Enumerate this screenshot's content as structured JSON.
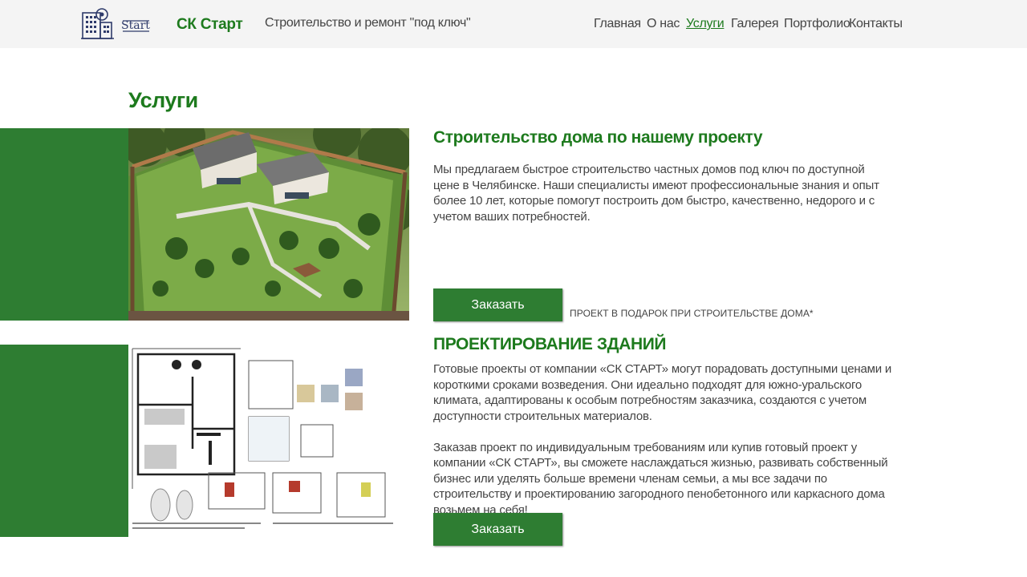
{
  "header": {
    "logo_text": "Start",
    "brand": "СК Старт",
    "tagline": "Строительство и ремонт \"под ключ\"",
    "nav": [
      {
        "label": "Главная",
        "active": false
      },
      {
        "label": "О нас",
        "active": false
      },
      {
        "label": "Услуги",
        "active": true
      },
      {
        "label": "Галерея",
        "active": false
      },
      {
        "label": "Портфолио",
        "active": false
      },
      {
        "label": "Контакты",
        "active": false
      }
    ]
  },
  "page": {
    "title": "Услуги"
  },
  "services": [
    {
      "title": "Строительство дома по нашему проекту",
      "paragraphs": [
        "Мы предлагаем быстрое строительство частных домов под ключ по доступной цене в Челябинске. Наши специалисты имеют профессиональные знания и опыт более 10 лет, которые помогут построить дом быстро, качественно, недорого и с учетом ваших потребностей."
      ],
      "button": "Заказать",
      "promo": "ПРОЕКТ В ПОДАРОК ПРИ СТРОИТЕЛЬСТВЕ ДОМА*",
      "image_icon": "house-render-image"
    },
    {
      "title": "ПРОЕКТИРОВАНИЕ ЗДАНИЙ",
      "paragraphs": [
        "Готовые проекты от компании «СК СТАРТ» могут порадовать доступными ценами и короткими сроками возведения. Они идеально подходят для южно-уральского климата, адаптированы к особым потребностям заказчика, создаются с учетом доступности строительных материалов.",
        "Заказав проект по индивидуальным требованиям или купив готовый проект у компании «СК СТАРТ», вы сможете наслаждаться жизнью, развивать собственный бизнес или уделять больше времени членам семьи, а мы все задачи по строительству и проектированию загородного пенобетонного или каркасного дома возьмем на себя!"
      ],
      "button": "Заказать",
      "image_icon": "floor-plan-image"
    }
  ],
  "colors": {
    "brand_green": "#1d7a1d",
    "block_green": "#2e7d32",
    "header_bg": "#f4f4f4",
    "text": "#444444"
  }
}
